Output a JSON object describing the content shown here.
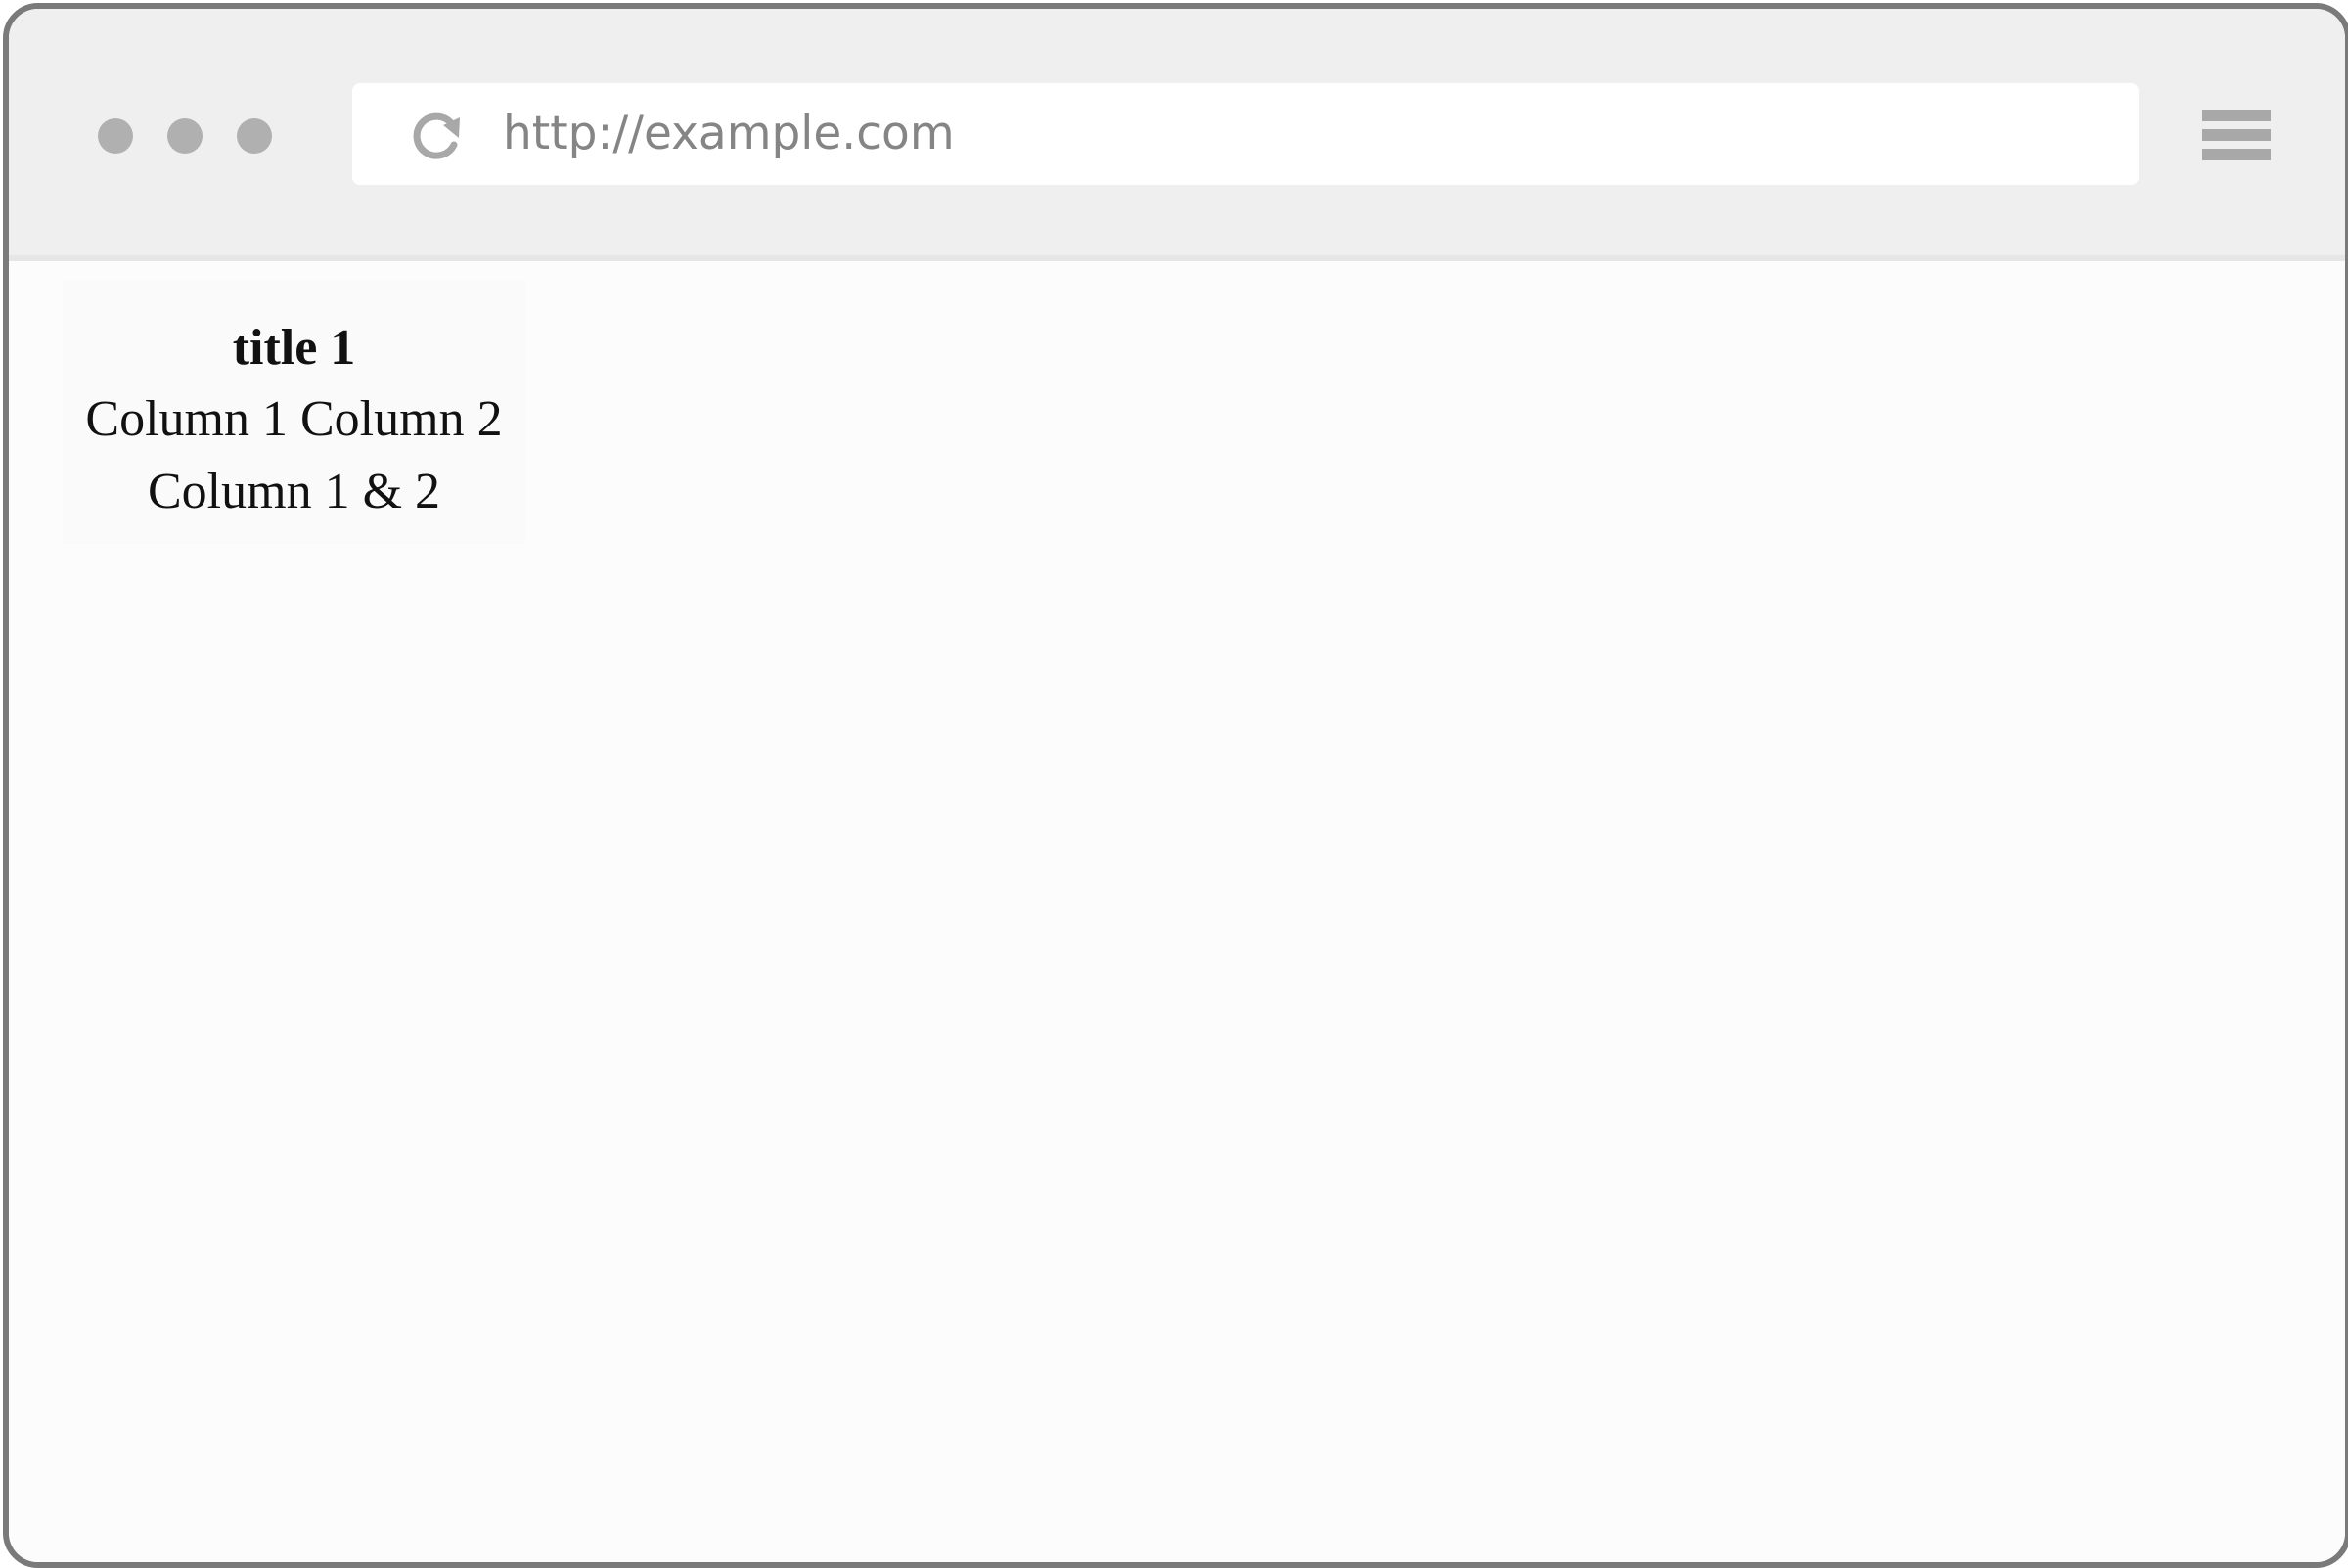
{
  "browser": {
    "url": "http://example.com",
    "controls": {
      "reload_icon": "reload-icon",
      "menu_icon": "hamburger-menu-icon"
    }
  },
  "page": {
    "table": {
      "title": "title 1",
      "columns": [
        "Column 1",
        "Column 2"
      ],
      "merged_cell": "Column 1 & 2"
    }
  }
}
